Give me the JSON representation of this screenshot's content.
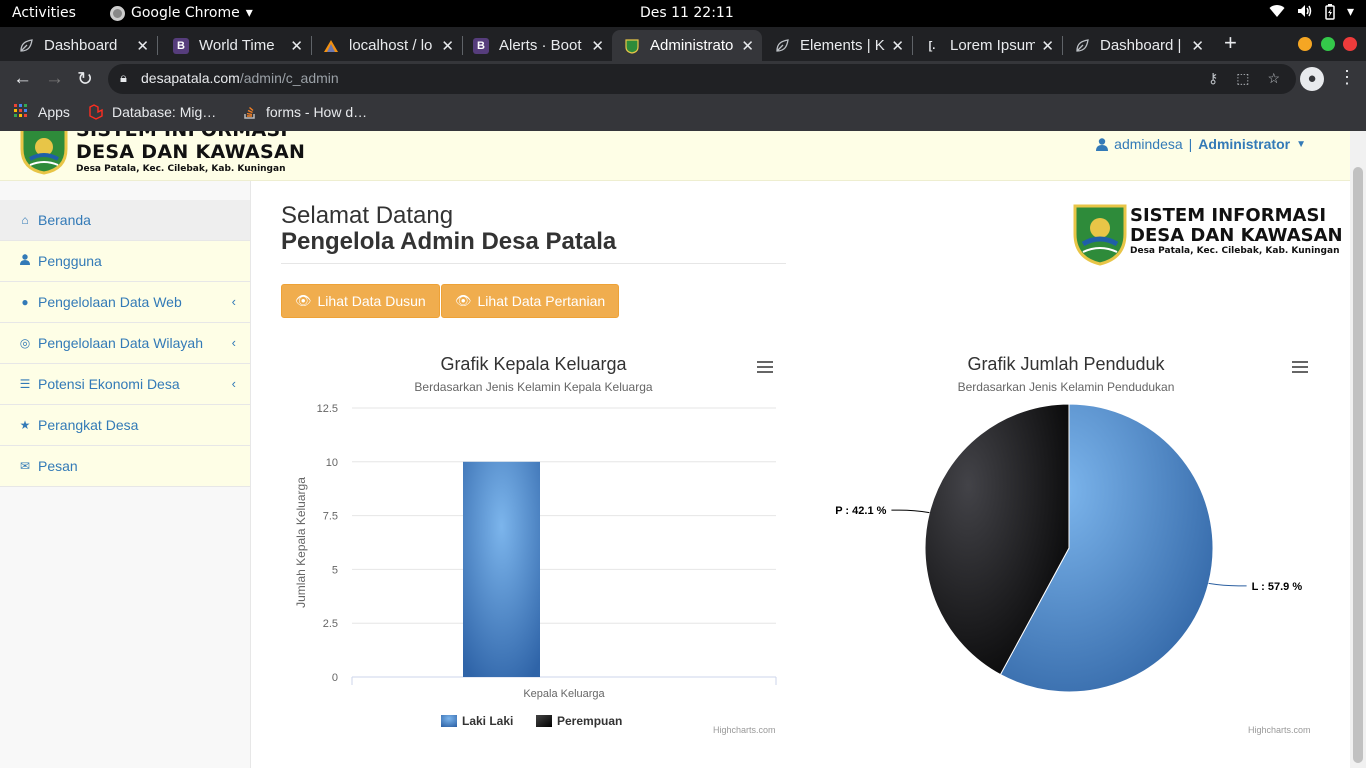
{
  "os": {
    "activities": "Activities",
    "app_name": "Google Chrome",
    "clock": "Des 11  22:11"
  },
  "browser": {
    "tabs": [
      {
        "title": "Dashboard",
        "icon": "leaf-icon"
      },
      {
        "title": "World Time",
        "icon": "bootstrap-b-icon"
      },
      {
        "title": "localhost / lo",
        "icon": "phpmyadmin-sail-icon"
      },
      {
        "title": "Alerts · Boot",
        "icon": "bootstrap-b-icon"
      },
      {
        "title": "Administrato",
        "icon": "village-seal-icon",
        "active": true
      },
      {
        "title": "Elements | Ki",
        "icon": "leaf-icon"
      },
      {
        "title": "Lorem Ipsum",
        "icon": "lorem-bracket-icon"
      },
      {
        "title": "Dashboard |",
        "icon": "leaf-icon"
      }
    ],
    "url_host": "desapatala.com",
    "url_path": "/admin/c_admin",
    "bookmarks": [
      {
        "label": "Apps",
        "icon": "apps-grid-icon"
      },
      {
        "label": "Database: Mig…",
        "icon": "laravel-icon"
      },
      {
        "label": "forms - How d…",
        "icon": "stackoverflow-icon"
      }
    ]
  },
  "site": {
    "logo_line1": "SISTEM INFORMASI",
    "logo_line2": "DESA DAN KAWASAN",
    "logo_line3": "Desa Patala, Kec. Cilebak, Kab. Kuningan",
    "user_name": "admindesa",
    "user_separator": "|",
    "user_role": "Administrator"
  },
  "sidebar": {
    "items": [
      {
        "label": "Beranda",
        "icon": "home-icon",
        "active": true
      },
      {
        "label": "Pengguna",
        "icon": "user-icon"
      },
      {
        "label": "Pengelolaan Data Web",
        "icon": "globe-icon",
        "has_submenu": true
      },
      {
        "label": "Pengelolaan Data Wilayah",
        "icon": "compass-icon",
        "has_submenu": true
      },
      {
        "label": "Potensi Ekonomi Desa",
        "icon": "list-icon",
        "has_submenu": true
      },
      {
        "label": "Perangkat Desa",
        "icon": "star-icon"
      },
      {
        "label": "Pesan",
        "icon": "envelope-icon"
      }
    ]
  },
  "main": {
    "welcome_line1": "Selamat Datang",
    "welcome_line2": "Pengelola Admin Desa Patala",
    "buttons": [
      {
        "label": "Lihat Data Dusun"
      },
      {
        "label": "Lihat Data Pertanian"
      }
    ]
  },
  "colors": {
    "link": "#337ab7",
    "button": "#f0ad4e",
    "header_bg": "#fefee6",
    "series_laki": "#3d7cc9",
    "series_perempuan": "#1a1a1a"
  },
  "chart_data": [
    {
      "type": "bar",
      "title": "Grafik Kepala Keluarga",
      "subtitle": "Berdasarkan Jenis Kelamin Kepala Keluarga",
      "xlabel": "Kepala Keluarga",
      "ylabel": "Jumlah Kepala Keluarga",
      "categories": [
        "Kepala Keluarga"
      ],
      "ylim": [
        0,
        12.5
      ],
      "yticks": [
        0,
        2.5,
        5,
        7.5,
        10,
        12.5
      ],
      "series": [
        {
          "name": "Laki Laki",
          "values": [
            10
          ]
        },
        {
          "name": "Perempuan",
          "values": [
            0
          ]
        }
      ],
      "legend": "bottom-center",
      "grid": true,
      "credits": "Highcharts.com"
    },
    {
      "type": "pie",
      "title": "Grafik Jumlah Penduduk",
      "subtitle": "Berdasarkan Jenis Kelamin Pendudukan",
      "slices": [
        {
          "label": "L : 57.9 %",
          "value": 57.9
        },
        {
          "label": "P : 42.1 %",
          "value": 42.1
        }
      ],
      "credits": "Highcharts.com"
    }
  ]
}
